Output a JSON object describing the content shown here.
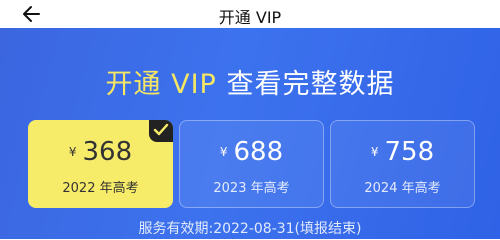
{
  "header": {
    "back_icon": "arrow-left-icon",
    "title": "开通 VIP"
  },
  "hero": {
    "headline_highlight": "开通 VIP",
    "headline_rest": " 查看完整数据",
    "highlight_color": "#f5e663"
  },
  "plans": [
    {
      "currency": "¥",
      "price": "368",
      "label": "2022 年高考",
      "selected": true
    },
    {
      "currency": "¥",
      "price": "688",
      "label": "2023 年高考",
      "selected": false
    },
    {
      "currency": "¥",
      "price": "758",
      "label": "2024 年高考",
      "selected": false
    }
  ],
  "selected_badge_icon": "checkmark-icon",
  "service_period": "服务有效期:2022-08-31(填报结束)",
  "colors": {
    "panel": "#3d72ee",
    "selected_card": "#f7ec6a"
  }
}
